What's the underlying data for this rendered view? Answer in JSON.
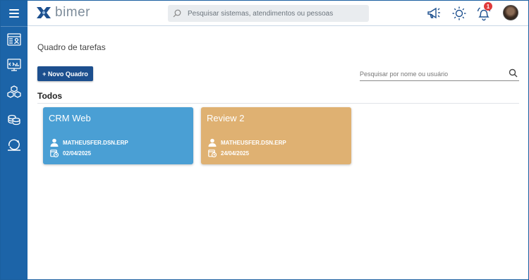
{
  "app": {
    "logo_text": "bimer"
  },
  "header": {
    "search_placeholder": "Pesquisar sistemas, atendimentos ou pessoas",
    "notification_count": "1"
  },
  "sidebar": {
    "items": [
      {
        "icon": "id-card-icon"
      },
      {
        "icon": "dashboard-code-icon"
      },
      {
        "icon": "boxes-icon"
      },
      {
        "icon": "coins-icon"
      },
      {
        "icon": "cycle-icon"
      }
    ]
  },
  "main": {
    "title": "Quadro de tarefas",
    "new_board_label": "+ Novo Quadro",
    "board_search_placeholder": "Pesquisar por nome ou usuário",
    "section_title": "Todos"
  },
  "boards": [
    {
      "title": "CRM Web",
      "user": "MATHEUSFER.DSN.ERP",
      "date": "02/04/2025",
      "color": "#4a9fd4"
    },
    {
      "title": "Review 2",
      "user": "MATHEUSFER.DSN.ERP",
      "date": "24/04/2025",
      "color": "#dfb172"
    }
  ],
  "colors": {
    "sidebar": "#1c64a8",
    "primary_button": "#1c4f8e",
    "badge": "#e03a3a"
  }
}
